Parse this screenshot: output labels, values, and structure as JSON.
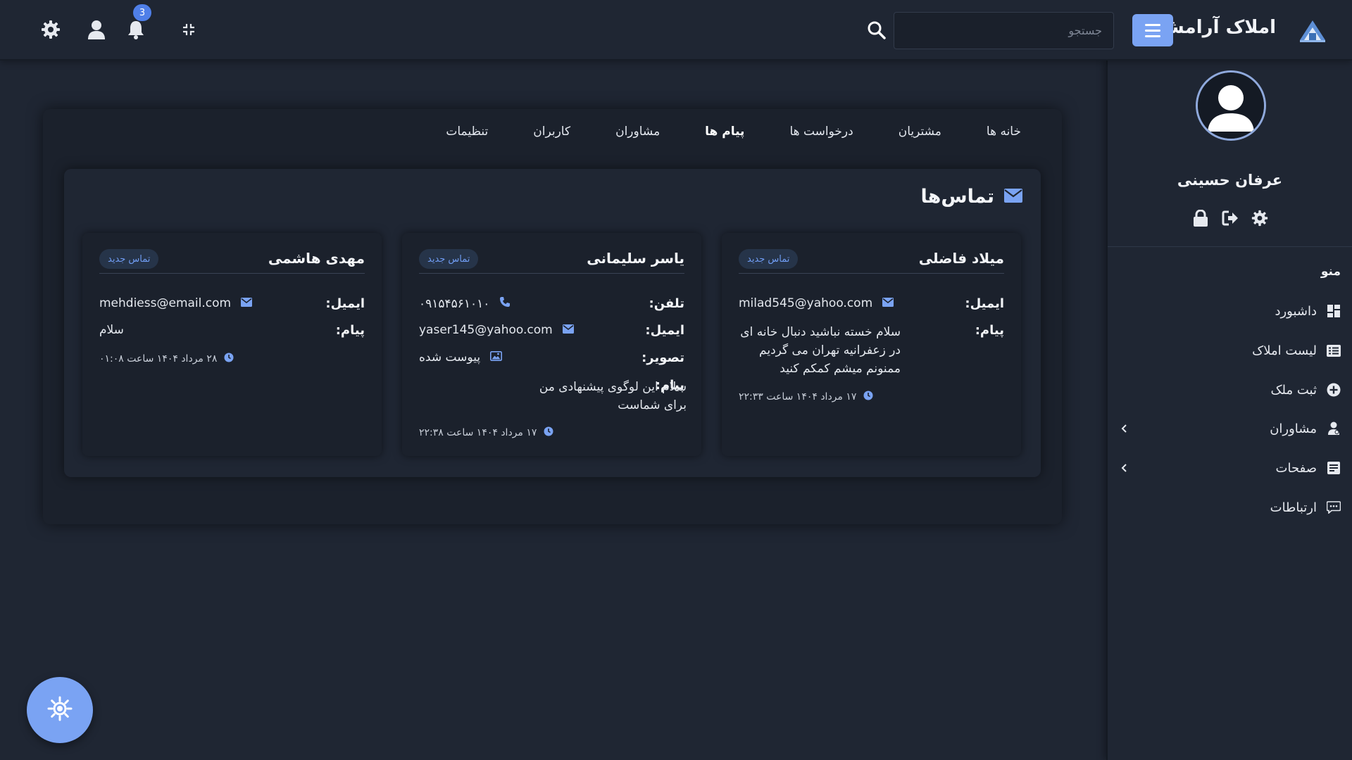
{
  "topbar": {
    "brand": "املاک آرامش",
    "search_placeholder": "جستجو",
    "notification_count": "3"
  },
  "sidebar": {
    "user_name": "عرفان حسینی",
    "menu_title": "منو",
    "items": [
      {
        "label": "داشبورد",
        "icon": "dashboard-icon"
      },
      {
        "label": "لیست املاک",
        "icon": "list-icon"
      },
      {
        "label": "ثبت ملک",
        "icon": "add-circle-icon"
      },
      {
        "label": "مشاوران",
        "icon": "users-icon",
        "has_submenu": true
      },
      {
        "label": "صفحات",
        "icon": "pages-icon",
        "has_submenu": true
      },
      {
        "label": "ارتباطات",
        "icon": "chat-icon"
      }
    ]
  },
  "tabs": [
    "خانه ها",
    "مشتریان",
    "درخواست ها",
    "پیام ها",
    "مشاوران",
    "کاربران",
    "تنظیمات"
  ],
  "active_tab": "پیام ها",
  "contacts": {
    "title": "تماس‌ها",
    "cards": [
      {
        "name": "میلاد فاضلی",
        "badge": "تماس جدید",
        "email_label": "ایمیل:",
        "email": "milad545@yahoo.com",
        "message_label": "پیام:",
        "message": "سلام خسته نباشید دنبال خانه ای در زعفرانیه تهران می گردیم ممنونم میشم کمکم کنید",
        "date": "۱۷ مرداد ۱۴۰۴ ساعت ۲۲:۳۳"
      },
      {
        "name": "یاسر سلیمانی",
        "badge": "تماس جدید",
        "phone_label": "تلفن:",
        "phone": "۰۹۱۵۴۵۶۱۰۱۰",
        "email_label": "ایمیل:",
        "email": "yaser145@yahoo.com",
        "image_label": "تصویر:",
        "image": "پیوست شده",
        "message_label": "پیام:",
        "message": "سلام این لوگوی پیشنهادی من برای شماست",
        "date": "۱۷ مرداد ۱۴۰۴ ساعت ۲۲:۳۸"
      },
      {
        "name": "مهدی هاشمی",
        "badge": "تماس جدید",
        "email_label": "ایمیل:",
        "email": "mehdiess@email.com",
        "message_label": "پیام:",
        "message": "سلام",
        "date": "۲۸ مرداد ۱۴۰۴ ساعت ۰۱:۰۸"
      }
    ]
  },
  "colors": {
    "accent": "#7aa3f3",
    "background": "#1f2633",
    "panel": "#1b212c",
    "badge_text": "#6f9cf2"
  }
}
